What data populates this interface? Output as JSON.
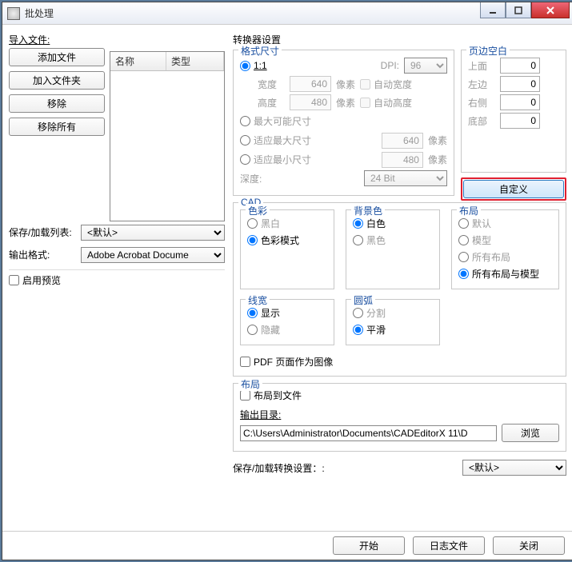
{
  "window": {
    "title": "批处理"
  },
  "left": {
    "import_label": "导入文件:",
    "btn_add_file": "添加文件",
    "btn_add_folder": "加入文件夹",
    "btn_remove": "移除",
    "btn_remove_all": "移除所有",
    "col_name": "名称",
    "col_type": "类型",
    "save_list_label": "保存/加载列表:",
    "save_list_value": "<默认>",
    "output_format_label": "输出格式:",
    "output_format_value": "Adobe Acrobat Docume",
    "enable_preview": "启用预览"
  },
  "converter": {
    "heading": "转换器设置",
    "format_legend": "格式尺寸",
    "one_to_one": "1:1",
    "dpi_label": "DPI:",
    "dpi_value": "96",
    "width_label": "宽度",
    "width_value": "640",
    "height_label": "高度",
    "height_value": "480",
    "pixel_unit": "像素",
    "auto_width": "自动宽度",
    "auto_height": "自动高度",
    "max_possible": "最大可能尺寸",
    "fit_max": "适应最大尺寸",
    "fit_max_value": "640",
    "fit_min": "适应最小尺寸",
    "fit_min_value": "480",
    "depth_label": "深度:",
    "depth_value": "24 Bit",
    "margins": {
      "legend": "页边空白",
      "top_label": "上面",
      "left_label": "左边",
      "right_label": "右侧",
      "bottom_label": "底部",
      "top": "0",
      "left": "0",
      "right": "0",
      "bottom": "0"
    },
    "custom_btn": "自定义",
    "cad": {
      "legend": "CAD",
      "color_legend": "色彩",
      "color_bw": "黑白",
      "color_mode": "色彩模式",
      "bg_legend": "背景色",
      "bg_white": "白色",
      "bg_black": "黑色",
      "layout_legend": "布局",
      "layout_default": "默认",
      "layout_model": "模型",
      "layout_all": "所有布局",
      "layout_all_model": "所有布局与模型",
      "lw_legend": "线宽",
      "lw_show": "显示",
      "lw_hide": "隐藏",
      "arc_legend": "圆弧",
      "arc_split": "分割",
      "arc_smooth": "平滑",
      "pdf_as_image": "PDF 页面作为图像"
    },
    "layout": {
      "legend": "布局",
      "to_file": "布局到文件",
      "outdir_label": "输出目录:",
      "outdir_value": "C:\\Users\\Administrator\\Documents\\CADEditorX 11\\D",
      "browse": "浏览"
    },
    "save_settings_label": "保存/加载转换设置：:",
    "save_settings_value": "<默认>"
  },
  "footer": {
    "start": "开始",
    "log": "日志文件",
    "close": "关闭"
  }
}
